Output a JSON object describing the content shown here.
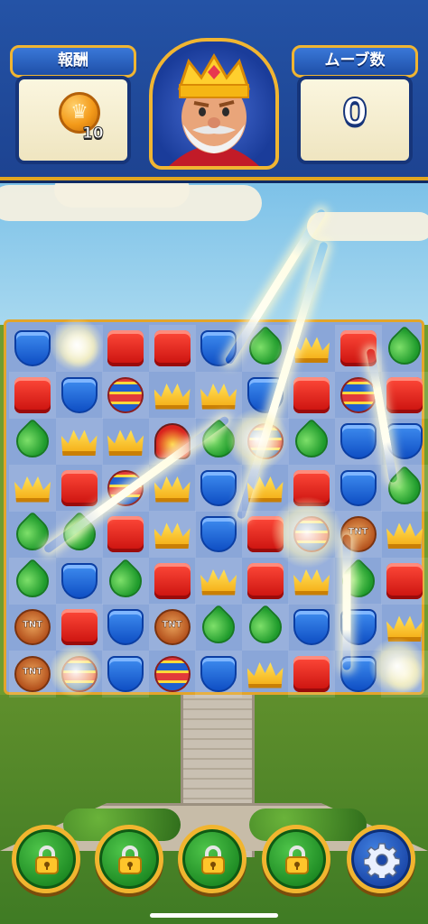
{
  "hud": {
    "reward_label": "報酬",
    "reward_count": "10",
    "moves_label": "ムーブ数",
    "moves_value": "0",
    "avatar": "king-avatar"
  },
  "board": {
    "columns": 9,
    "rows": 8,
    "pieces": [
      [
        "blue",
        "sparkle",
        "red",
        "red",
        "blue",
        "green",
        "crown",
        "red",
        "green"
      ],
      [
        "red",
        "blue",
        "toy",
        "crown",
        "crown",
        "blue",
        "red",
        "toy",
        "red"
      ],
      [
        "green",
        "crown",
        "crown",
        "propeller",
        "green",
        "toy",
        "green",
        "blue",
        "blue"
      ],
      [
        "crown",
        "red",
        "toy",
        "crown",
        "blue",
        "crown",
        "red",
        "blue",
        "green"
      ],
      [
        "green",
        "green",
        "red",
        "crown",
        "blue",
        "red",
        "toy",
        "tnt",
        "crown"
      ],
      [
        "green",
        "blue",
        "green",
        "red",
        "crown",
        "red",
        "crown",
        "green",
        "red"
      ],
      [
        "tnt",
        "red",
        "blue",
        "tnt",
        "green",
        "green",
        "blue",
        "blue",
        "crown"
      ],
      [
        "tnt",
        "toy",
        "blue",
        "toy",
        "blue",
        "crown",
        "red",
        "blue",
        "sparkle"
      ]
    ],
    "tnt_label": "TNT"
  },
  "boosters": [
    {
      "name": "booster-1",
      "icon": "lock-icon",
      "locked": true
    },
    {
      "name": "booster-2",
      "icon": "lock-icon",
      "locked": true
    },
    {
      "name": "booster-3",
      "icon": "lock-icon",
      "locked": true
    },
    {
      "name": "booster-4",
      "icon": "lock-icon",
      "locked": true
    },
    {
      "name": "settings",
      "icon": "gear-icon",
      "locked": false
    }
  ],
  "colors": {
    "hud_blue": "#1d4391",
    "gold": "#f0b532",
    "booster_green": "#1d8a23",
    "settings_blue": "#1b47a8"
  }
}
